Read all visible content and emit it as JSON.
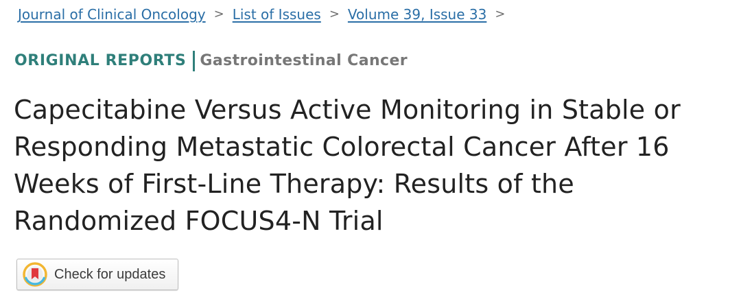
{
  "breadcrumb": {
    "items": [
      {
        "label": "Journal of Clinical Oncology"
      },
      {
        "label": "List of Issues"
      },
      {
        "label": "Volume 39, Issue 33"
      }
    ],
    "separator": ">"
  },
  "article": {
    "type": "ORIGINAL REPORTS",
    "subject": "Gastrointestinal Cancer",
    "title": "Capecitabine Versus Active Monitoring in Stable or Responding Metastatic Colorectal Cancer After 16 Weeks of First-Line Therapy: Results of the Randomized FOCUS4-N Trial"
  },
  "check_updates": {
    "label": "Check for updates",
    "icon": "crossmark-icon"
  },
  "colors": {
    "link": "#2a6ea6",
    "section_accent": "#2f7f7a",
    "subject_gray": "#777777",
    "title_text": "#222222"
  }
}
